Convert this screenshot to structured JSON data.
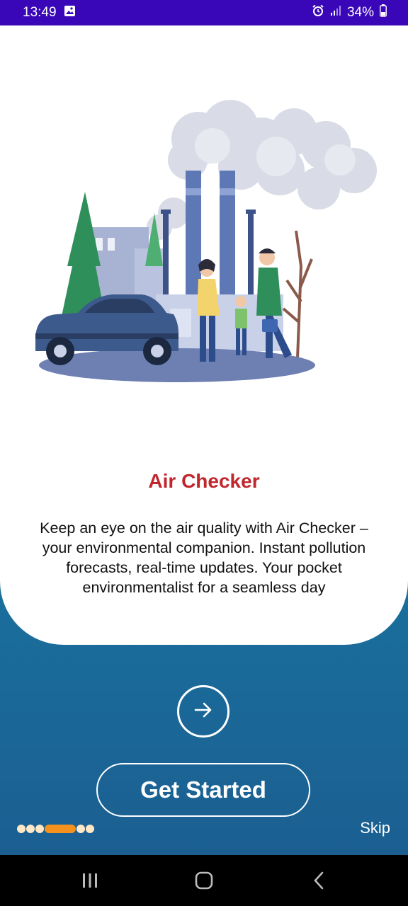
{
  "status_bar": {
    "time": "13:49",
    "battery": "34%",
    "icons": [
      "image-icon",
      "alarm-icon",
      "signal-icon",
      "battery-icon"
    ]
  },
  "onboarding": {
    "illustration": "city-pollution-family-illustration",
    "title": "Air Checker",
    "description": "Keep an eye on the air quality with Air Checker – your environmental companion. Instant pollution forecasts, real-time updates. Your pocket environmentalist for a seamless day",
    "next_icon": "arrow-right-icon",
    "get_started_label": "Get Started",
    "skip_label": "Skip",
    "page_count": 6,
    "current_page": 4
  },
  "nav_bar": {
    "buttons": [
      "recent-apps-icon",
      "home-icon",
      "back-icon"
    ]
  },
  "colors": {
    "status_bar": "#3a07b8",
    "title": "#c0272d",
    "background_top": "#1f9ab3",
    "background_bottom": "#1b5c8f",
    "active_dot": "#f5921e",
    "inactive_dot": "#ffe8c7"
  }
}
